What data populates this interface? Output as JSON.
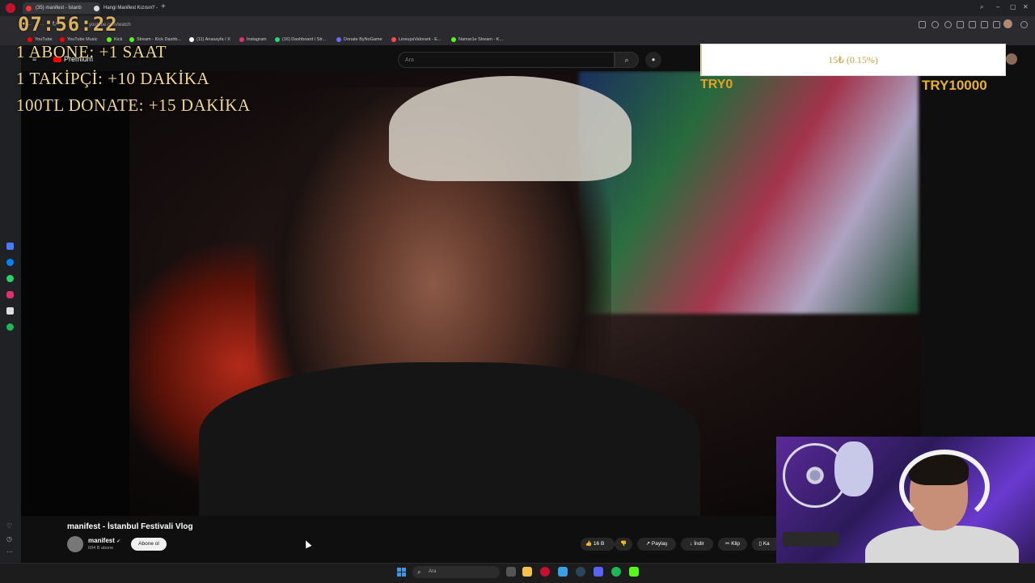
{
  "browser": {
    "tabs": [
      {
        "label": "(35) manifest - İstanb",
        "color": "#ff3333",
        "active": true
      },
      {
        "label": "Hangi Manifest Kızısın? -",
        "color": "#dddddd",
        "active": false
      }
    ],
    "url": "youtube.com/watch",
    "bookmarks": [
      {
        "label": "YouTube",
        "color": "#ff0000"
      },
      {
        "label": "YouTube Music",
        "color": "#ff0000"
      },
      {
        "label": "Kick",
        "color": "#53fc18"
      },
      {
        "label": "Stream - Kick Dashb...",
        "color": "#53fc18"
      },
      {
        "label": "(11) Anasayfa / X",
        "color": "#ffffff"
      },
      {
        "label": "Instagram",
        "color": "#e1306c"
      },
      {
        "label": "(16) Dashboard / Str...",
        "color": "#2bd47a"
      },
      {
        "label": "Donate ByNoGame",
        "color": "#6a6aff"
      },
      {
        "label": "LineupsValorant - E...",
        "color": "#ff4655"
      },
      {
        "label": "Namar1e Stream - K...",
        "color": "#53fc18"
      }
    ]
  },
  "youtube": {
    "logo_text": "Premium",
    "search_placeholder": "Ara",
    "video_title": "manifest - İstanbul Festivali Vlog",
    "channel_name": "manifest",
    "subscriber_count": "694 B abone",
    "subscribe_label": "Abone ol",
    "actions": {
      "likes": "16 B",
      "share": "Paylaş",
      "download": "İndir",
      "clip": "Klip",
      "save": "Ka"
    }
  },
  "overlay": {
    "timer": "07:56:22",
    "rules": [
      "1 ABONE: +1 SAAT",
      "1 TAKİPÇİ: +10 DAKİKA",
      "100TL DONATE: +15 DAKİKA"
    ],
    "goal_text": "15₺ (0.15%)",
    "goal_fraction": 0.0015,
    "goal_min": "TRY0",
    "goal_max": "TRY10000",
    "accent_color": "#f2d88e"
  },
  "taskbar": {
    "search_placeholder": "Ara"
  }
}
